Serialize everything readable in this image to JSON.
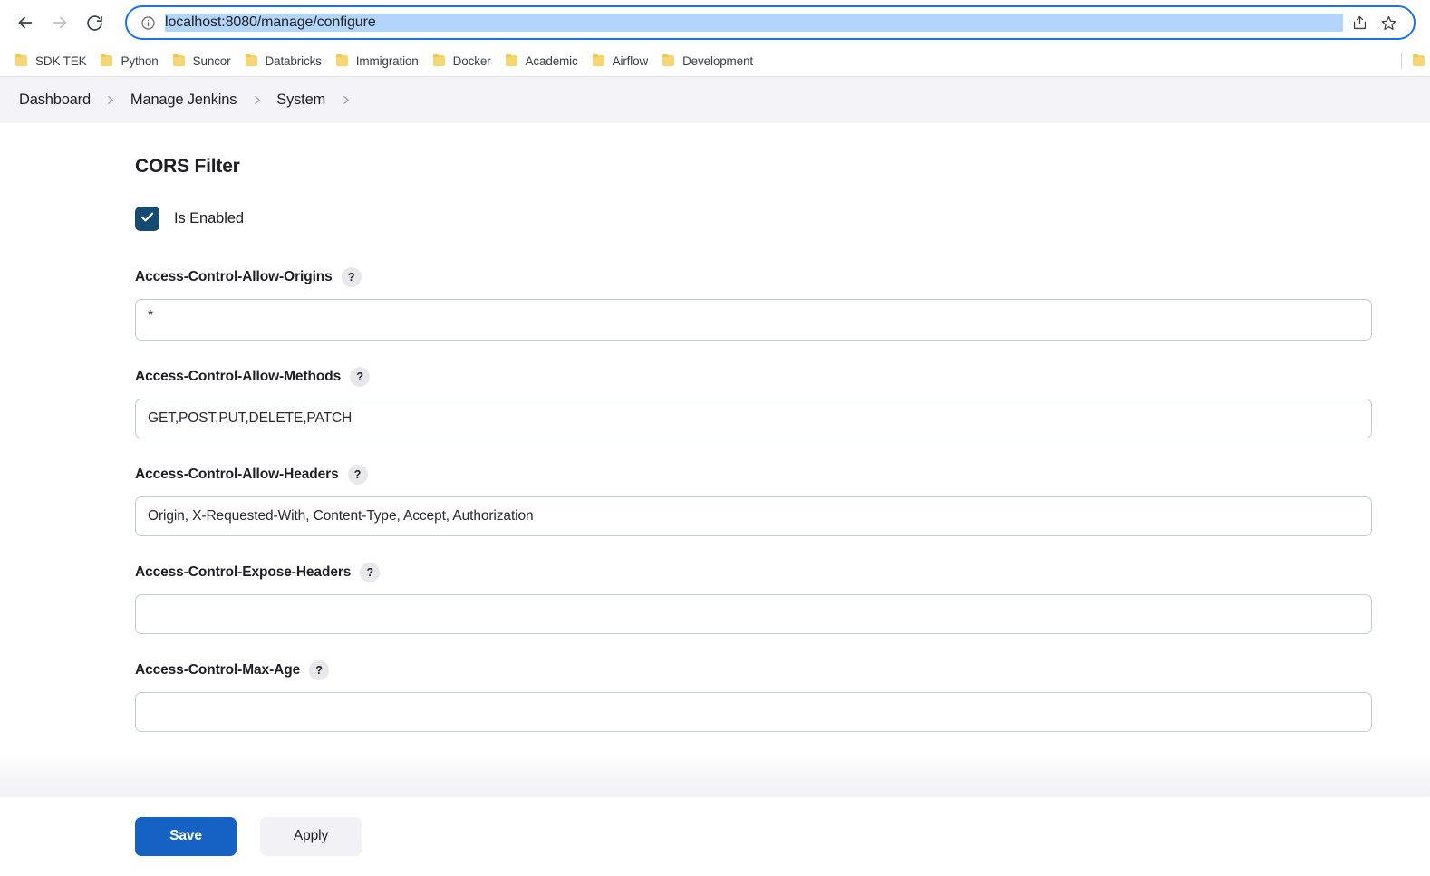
{
  "browser": {
    "back_icon": "arrow-left-icon",
    "forward_icon": "arrow-right-icon",
    "reload_icon": "reload-icon",
    "site_info_icon": "info-circle-icon",
    "url": "localhost:8080/manage/configure",
    "url_placeholder": "Search Google or type a URL",
    "share_icon": "share-icon",
    "bookmark_star_icon": "star-icon",
    "bookmarks": [
      {
        "label": "SDK TEK",
        "icon": "folder-icon"
      },
      {
        "label": "Python",
        "icon": "folder-icon"
      },
      {
        "label": "Suncor",
        "icon": "folder-icon"
      },
      {
        "label": "Databricks",
        "icon": "folder-icon"
      },
      {
        "label": "Immigration",
        "icon": "folder-icon"
      },
      {
        "label": "Docker",
        "icon": "folder-icon"
      },
      {
        "label": "Academic",
        "icon": "folder-icon"
      },
      {
        "label": "Airflow",
        "icon": "folder-icon"
      },
      {
        "label": "Development",
        "icon": "folder-icon"
      }
    ]
  },
  "breadcrumb": {
    "items": [
      "Dashboard",
      "Manage Jenkins",
      "System"
    ],
    "separator_icon": "chevron-right-icon"
  },
  "section": {
    "title": "CORS Filter"
  },
  "enabled_checkbox": {
    "label": "Is Enabled",
    "checked": true,
    "check_icon": "check-icon",
    "color": "#154b72"
  },
  "fields": [
    {
      "label": "Access-Control-Allow-Origins",
      "help_icon": "question-mark-icon",
      "help_label": "?",
      "value": "*",
      "placeholder": "",
      "multiline": true
    },
    {
      "label": "Access-Control-Allow-Methods",
      "help_icon": "question-mark-icon",
      "help_label": "?",
      "value": "GET,POST,PUT,DELETE,PATCH",
      "placeholder": "",
      "multiline": false
    },
    {
      "label": "Access-Control-Allow-Headers",
      "help_icon": "question-mark-icon",
      "help_label": "?",
      "value": "Origin, X-Requested-With, Content-Type, Accept, Authorization",
      "placeholder": "",
      "multiline": false
    },
    {
      "label": "Access-Control-Expose-Headers",
      "help_icon": "question-mark-icon",
      "help_label": "?",
      "value": "",
      "placeholder": "",
      "multiline": false
    },
    {
      "label": "Access-Control-Max-Age",
      "help_icon": "question-mark-icon",
      "help_label": "?",
      "value": "",
      "placeholder": "",
      "multiline": false
    }
  ],
  "actions": {
    "save_label": "Save",
    "apply_label": "Apply",
    "save_color": "#1661c4"
  }
}
